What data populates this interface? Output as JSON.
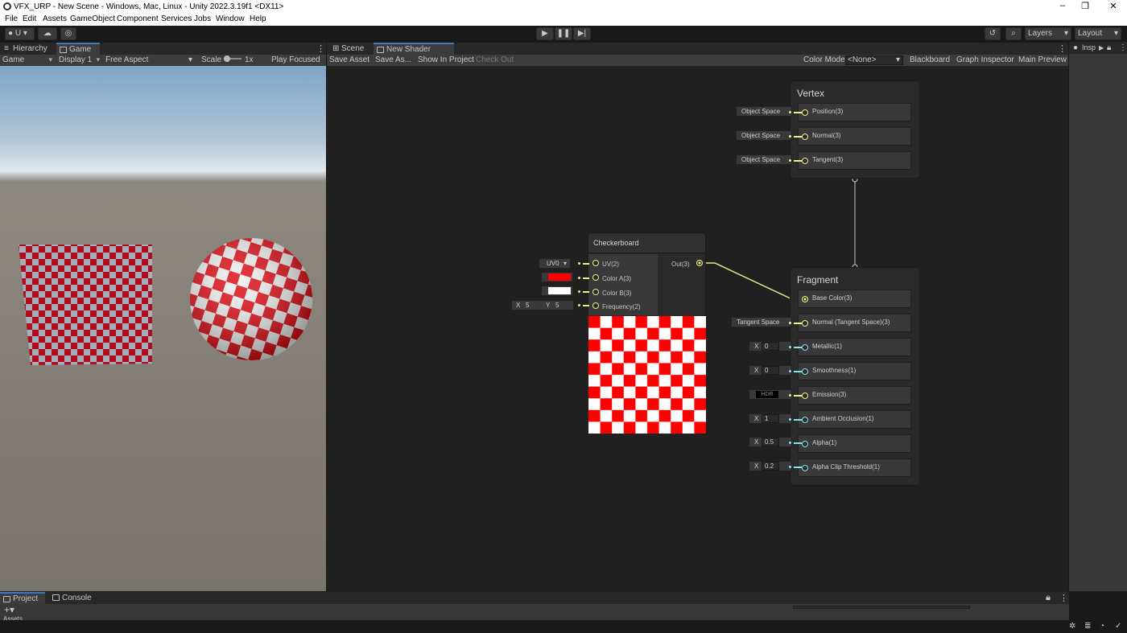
{
  "window": {
    "title": "VFX_URP - New Scene - Windows, Mac, Linux - Unity 2022.3.19f1 <DX11>"
  },
  "menu": [
    "File",
    "Edit",
    "Assets",
    "GameObject",
    "Component",
    "Services",
    "Jobs",
    "Window",
    "Help"
  ],
  "toolbar": {
    "account_label": "U",
    "layers_label": "Layers",
    "layout_label": "Layout"
  },
  "left_panel": {
    "tabs": [
      "Hierarchy",
      "Game"
    ],
    "game_bar": {
      "mode": "Game",
      "display": "Display 1",
      "aspect": "Free Aspect",
      "scale_label": "Scale",
      "scale_value": "1x",
      "play_focused": "Play Focused"
    }
  },
  "center_panel": {
    "tabs": [
      "Scene",
      "New Shader Graph"
    ],
    "actions": [
      "Save Asset",
      "Save As...",
      "Show In Project",
      "Check Out"
    ],
    "color_mode_label": "Color Mode",
    "color_mode_value": "<None>",
    "toggles": [
      "Blackboard",
      "Graph Inspector",
      "Main Preview"
    ]
  },
  "checkerboard_node": {
    "title": "Checkerboard",
    "inputs": [
      "UV(2)",
      "Color A(3)",
      "Color B(3)",
      "Frequency(2)"
    ],
    "output": "Out(3)",
    "uv_value": "UV0",
    "color_a": "#ff0000",
    "color_b": "#ffffff",
    "freq_x_label": "X",
    "freq_x": "5",
    "freq_y_label": "Y",
    "freq_y": "5"
  },
  "vertex_node": {
    "title": "Vertex",
    "slots": [
      {
        "label": "Position(3)",
        "input": "Object Space"
      },
      {
        "label": "Normal(3)",
        "input": "Object Space"
      },
      {
        "label": "Tangent(3)",
        "input": "Object Space"
      }
    ]
  },
  "fragment_node": {
    "title": "Fragment",
    "slots": [
      {
        "label": "Base Color(3)",
        "input": ""
      },
      {
        "label": "Normal (Tangent Space)(3)",
        "input": "Tangent Space"
      },
      {
        "label": "Metallic(1)",
        "axis": "X",
        "input": "0"
      },
      {
        "label": "Smoothness(1)",
        "axis": "X",
        "input": "0"
      },
      {
        "label": "Emission(3)",
        "input": "HDR"
      },
      {
        "label": "Ambient Occlusion(1)",
        "axis": "X",
        "input": "1"
      },
      {
        "label": "Alpha(1)",
        "axis": "X",
        "input": "0.5"
      },
      {
        "label": "Alpha Clip Threshold(1)",
        "axis": "X",
        "input": "0.2"
      }
    ]
  },
  "inspector": {
    "tab": "Insp"
  },
  "bottom_panel": {
    "tabs": [
      "Project",
      "Console"
    ],
    "folder": "Assets"
  },
  "colors": {
    "accent": "#3a79bb",
    "port_yellow": "#f0f08a",
    "port_blue": "#84e4f0",
    "checker_red": "#ff0000"
  }
}
